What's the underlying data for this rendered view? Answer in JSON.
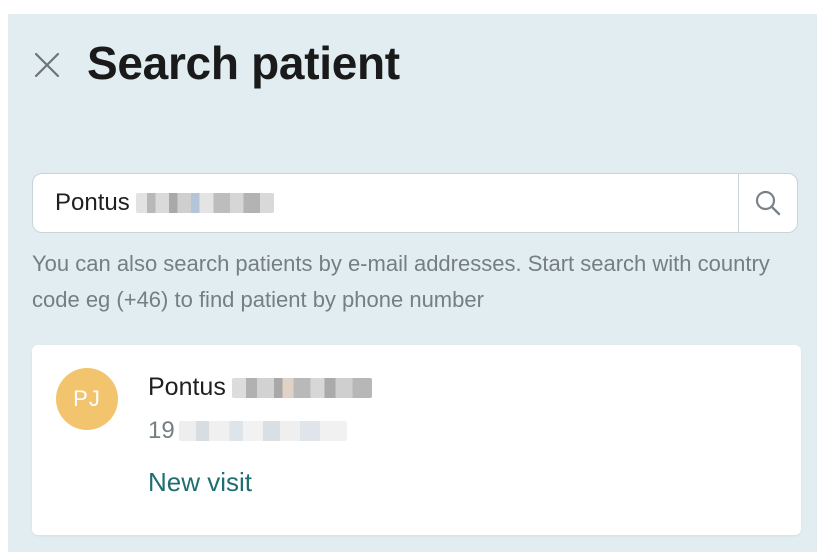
{
  "header": {
    "title": "Search patient",
    "close_icon": "close-icon"
  },
  "search": {
    "value": "Pontus",
    "search_icon": "search-icon"
  },
  "hint": {
    "text": "You can also search patients by e-mail addresses. Start search with country code eg (+46) to find patient by phone number"
  },
  "results": [
    {
      "initials": "PJ",
      "first_name": "Pontus",
      "id_prefix": "19",
      "action_label": "New visit",
      "avatar_color": "#f2c46d"
    }
  ],
  "colors": {
    "panel_bg": "#e1edf1",
    "link": "#1f6f70",
    "muted_text": "#757f83"
  }
}
